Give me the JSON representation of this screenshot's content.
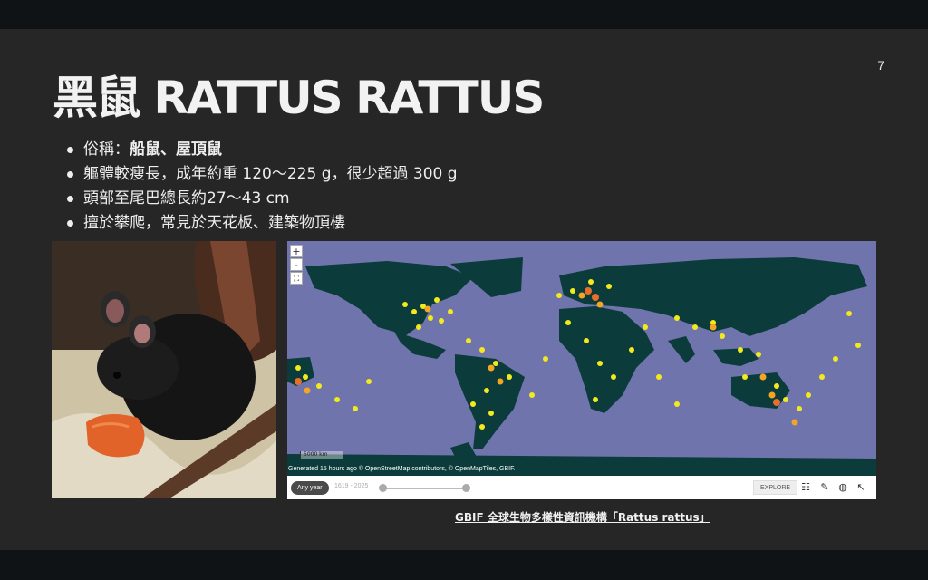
{
  "slide": {
    "page_number": "7",
    "title": "黑鼠 RATTUS RATTUS",
    "bullets": {
      "b1_prefix": "俗稱：",
      "b1_bold": "船鼠、屋頂鼠",
      "b2": "軀體較瘦長，成年約重 120～225 g，很少超過 300 g",
      "b3": "頭部至尾巴總長約27～43 cm",
      "b4": "擅於攀爬，常見於天花板、建築物頂樓"
    },
    "caption": "GBIF 全球生物多樣性資訊機構「Rattus rattus」"
  },
  "map": {
    "zoom_in": "+",
    "zoom_out": "-",
    "fullscreen": "⛶",
    "scale_label": "5000 km",
    "attribution": "Generated 15 hours ago © OpenStreetMap contributors, © OpenMapTiles, GBIF.",
    "year_button": "Any year",
    "year_range": "1619 - 2025",
    "explore_label": "EXPLORE",
    "colors": {
      "ocean": "#6f74ac",
      "land": "#0b3b3a",
      "low": "#f2ea1c",
      "mid": "#f4a623",
      "high": "#e86e2a"
    }
  },
  "icons": [
    "filter-icon",
    "brush-icon",
    "globe-icon",
    "pointer-icon"
  ]
}
